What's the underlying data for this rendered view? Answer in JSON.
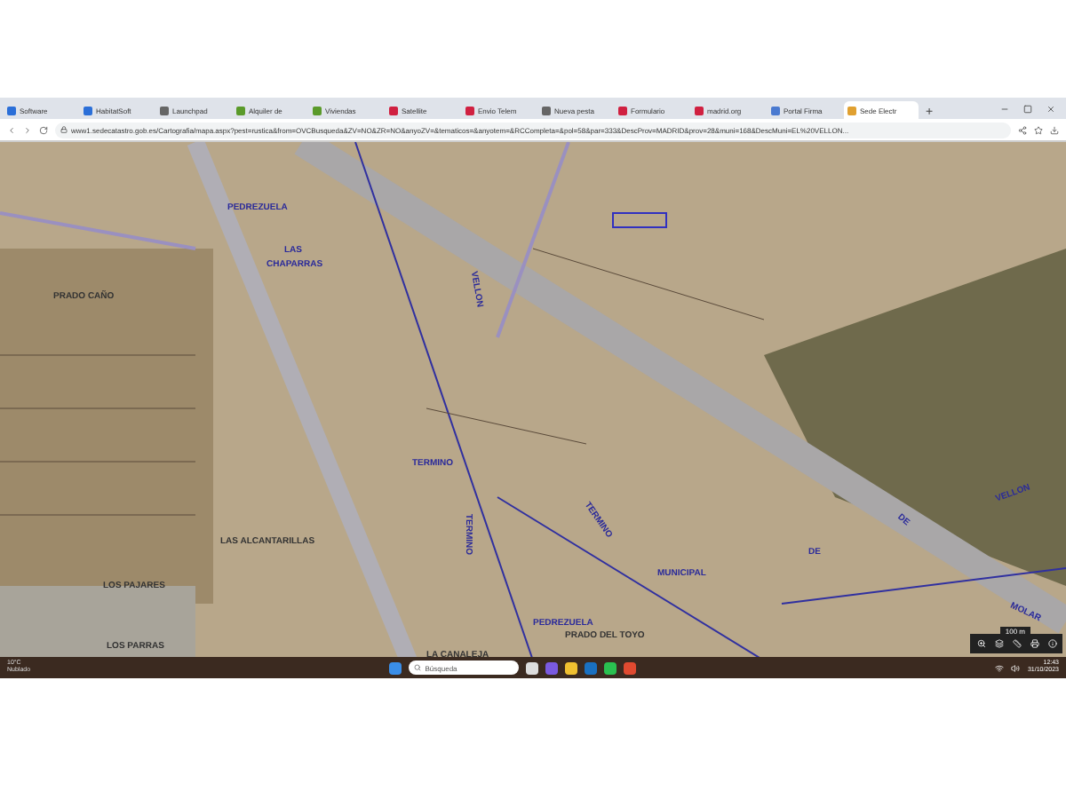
{
  "browser": {
    "tabs": [
      {
        "label": "Software",
        "selected": false
      },
      {
        "label": "HabitatSoft",
        "selected": false
      },
      {
        "label": "Launchpad",
        "selected": false
      },
      {
        "label": "Alquiler de",
        "selected": false
      },
      {
        "label": "Viviendas",
        "selected": false
      },
      {
        "label": "Satellite",
        "selected": false
      },
      {
        "label": "Envio Telem",
        "selected": false
      },
      {
        "label": "Nueva pesta",
        "selected": false
      },
      {
        "label": "Formulario",
        "selected": false
      },
      {
        "label": "madrid.org",
        "selected": false
      },
      {
        "label": "Portal Firma",
        "selected": false
      },
      {
        "label": "Sede Electr",
        "selected": true
      }
    ],
    "new_tab": "+",
    "url": "www1.sedecatastro.gob.es/Cartografia/mapa.aspx?pest=rustica&from=OVCBusqueda&ZV=NO&ZR=NO&anyoZV=&tematicos=&anyotem=&RCCompleta=&pol=58&par=333&DescProv=MADRID&prov=28&muni=168&DescMuni=EL%20VELLON..."
  },
  "map": {
    "labels": [
      "PEDREZUELA",
      "LAS",
      "CHAPARRAS",
      "PRADO CAÑO",
      "VELLON",
      "TERMINO",
      "TERMINO",
      "TERMINO",
      "MUNICIPAL",
      "DE",
      "DE",
      "MOLAR",
      "VELLON",
      "LOS PAJARES",
      "LAS ALCANTARILLAS",
      "PEDREZUELA",
      "PRADO DEL TOYO",
      "LOS PARRAS",
      "LA CANALEJA"
    ],
    "scale": "100 m"
  },
  "taskbar": {
    "weather_temp": "10°C",
    "weather_text": "Nublado",
    "search_placeholder": "Búsqueda",
    "time": "12:43",
    "date": "31/10/2023"
  }
}
